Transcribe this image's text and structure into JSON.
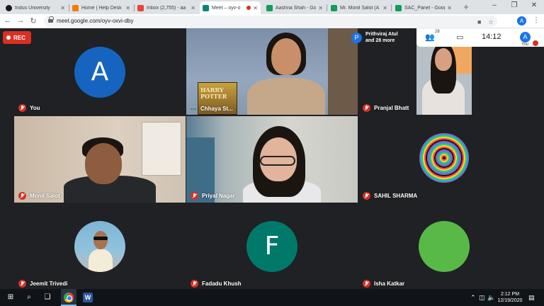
{
  "browser": {
    "tabs": [
      {
        "title": "Indus University",
        "favicon_color": "#1a1a1a",
        "active": false
      },
      {
        "title": "Home | Help Desk",
        "favicon_color": "#f57c00",
        "active": false
      },
      {
        "title": "Inbox (2,755) - aa",
        "favicon_color": "#ea4335",
        "active": false
      },
      {
        "title": "Meet – oyv-o",
        "favicon_color": "#00897b",
        "active": true
      },
      {
        "title": "Aashna Shah - Go",
        "favicon_color": "#0f9d58",
        "active": false
      },
      {
        "title": "Mr. Monil Salot (A",
        "favicon_color": "#0f9d58",
        "active": false
      },
      {
        "title": "SAC_Panel - Goog",
        "favicon_color": "#0f9d58",
        "active": false
      }
    ],
    "new_tab_label": "+",
    "url": "meet.google.com/oyv-oxvi-dby",
    "profile_initial": "A"
  },
  "meet": {
    "rec_label": "REC",
    "presenter": {
      "initial": "P",
      "line1": "Prithviraj Atul",
      "line2": "and 28 more"
    },
    "people_count": "28",
    "time": "14:12",
    "self_initial": "A",
    "self_label": "You",
    "tiles": [
      {
        "name": "You",
        "type": "avatar",
        "initial": "A",
        "color": "#1565c0",
        "speaking": false
      },
      {
        "name": "Chhaya St...",
        "type": "video",
        "speaking": true,
        "book_text": "HARRY POTTER"
      },
      {
        "name": "Pranjal Bhatt",
        "type": "video",
        "speaking": false
      },
      {
        "name": "Monil Salot",
        "type": "video",
        "speaking": false
      },
      {
        "name": "Priyal Nagar",
        "type": "video",
        "speaking": false
      },
      {
        "name": "SAHIL SHARMA",
        "type": "image",
        "speaking": false
      },
      {
        "name": "Jeemit Trivedi",
        "type": "image",
        "speaking": false
      },
      {
        "name": "Fadadu Khush",
        "type": "avatar",
        "initial": "F",
        "color": "#00796b",
        "speaking": false
      },
      {
        "name": "Isha Katkar",
        "type": "image",
        "speaking": false
      }
    ]
  },
  "taskbar": {
    "time": "2:12 PM",
    "date": "12/19/2020"
  }
}
